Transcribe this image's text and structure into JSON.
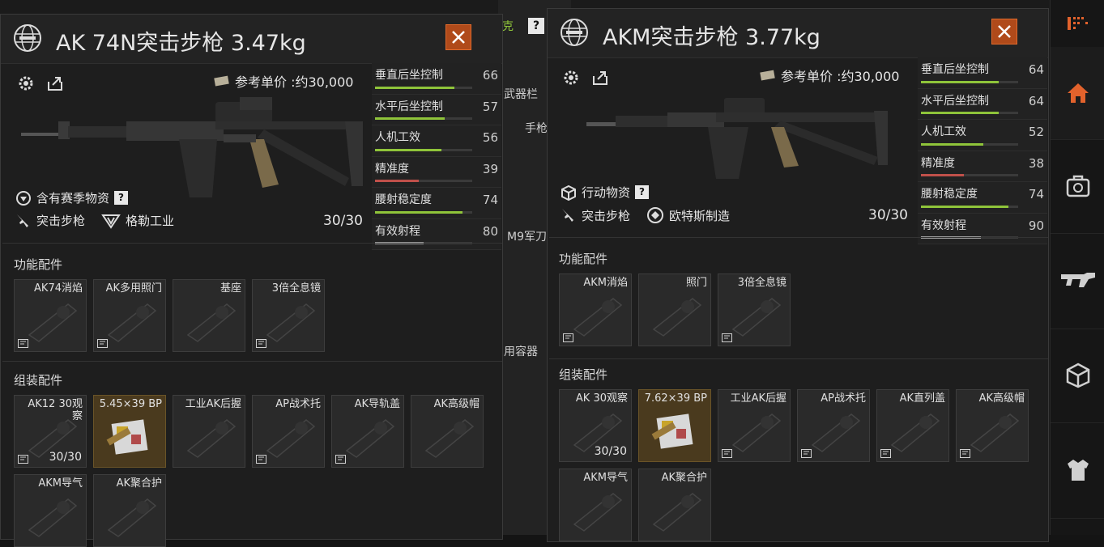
{
  "background": {
    "fragments": [
      "克",
      "武器栏",
      "手枪",
      "M9军刀",
      "用容器"
    ],
    "help_mark": "?"
  },
  "rail": {
    "items": [
      {
        "icon": "inventory-icon",
        "active": false
      },
      {
        "icon": "home-icon",
        "active": true
      },
      {
        "icon": "medkit-icon",
        "active": false
      },
      {
        "icon": "rifle-icon",
        "active": false
      },
      {
        "icon": "box-icon",
        "active": false
      },
      {
        "icon": "vest-icon",
        "active": false
      }
    ]
  },
  "panel_left": {
    "title": "AK 74N突击步枪 3.47kg",
    "price": "参考单价 :约30,000",
    "tag": "含有赛季物资",
    "help_mark": "?",
    "weapon_type": "突击步枪",
    "manufacturer": "格勒工业",
    "ammo": "30/30",
    "stats": [
      {
        "label": "垂直后坐控制",
        "value": "66",
        "fraction": 0.82,
        "color": "#8fc43a"
      },
      {
        "label": "水平后坐控制",
        "value": "57",
        "fraction": 0.72,
        "color": "#8fc43a"
      },
      {
        "label": "人机工效",
        "value": "56",
        "fraction": 0.68,
        "color": "#8fc43a"
      },
      {
        "label": "精准度",
        "value": "39",
        "fraction": 0.45,
        "color": "#c0504a"
      },
      {
        "label": "腰射稳定度",
        "value": "74",
        "fraction": 0.9,
        "color": "#8fc43a"
      },
      {
        "label": "有效射程",
        "value": "80",
        "fraction": 0.5,
        "color": "#9a9a9a"
      }
    ],
    "functional_title": "功能配件",
    "functional": [
      {
        "label": "AK74消焰",
        "gold": false,
        "count": "",
        "tag": true
      },
      {
        "label": "AK多用照门",
        "gold": false,
        "count": "",
        "tag": true
      },
      {
        "label": "基座",
        "gold": false,
        "count": "",
        "tag": false
      },
      {
        "label": "3倍全息镜",
        "gold": false,
        "count": "",
        "tag": true
      }
    ],
    "assembly_title": "组装配件",
    "assembly": [
      {
        "label": "AK12 30观察",
        "gold": false,
        "count": "30/30",
        "tag": true
      },
      {
        "label": "5.45×39 BP",
        "gold": true,
        "count": "",
        "tag": false
      },
      {
        "label": "工业AK后握",
        "gold": false,
        "count": "",
        "tag": false
      },
      {
        "label": "AP战术托",
        "gold": false,
        "count": "",
        "tag": true
      },
      {
        "label": "AK导轨盖",
        "gold": false,
        "count": "",
        "tag": true
      },
      {
        "label": "AK高级帽",
        "gold": false,
        "count": "",
        "tag": false
      },
      {
        "label": "AKM导气",
        "gold": false,
        "count": "",
        "tag": false
      },
      {
        "label": "AK聚合护",
        "gold": false,
        "count": "",
        "tag": false
      }
    ]
  },
  "panel_right": {
    "title": "AKM突击步枪 3.77kg",
    "price": "参考单价 :约30,000",
    "tag": "行动物资",
    "help_mark": "?",
    "weapon_type": "突击步枪",
    "manufacturer": "欧特斯制造",
    "ammo": "30/30",
    "stats": [
      {
        "label": "垂直后坐控制",
        "value": "64",
        "fraction": 0.8,
        "color": "#8fc43a"
      },
      {
        "label": "水平后坐控制",
        "value": "64",
        "fraction": 0.8,
        "color": "#8fc43a"
      },
      {
        "label": "人机工效",
        "value": "52",
        "fraction": 0.64,
        "color": "#8fc43a"
      },
      {
        "label": "精准度",
        "value": "38",
        "fraction": 0.44,
        "color": "#c0504a"
      },
      {
        "label": "腰射稳定度",
        "value": "74",
        "fraction": 0.9,
        "color": "#8fc43a"
      },
      {
        "label": "有效射程",
        "value": "90",
        "fraction": 0.62,
        "color": "#9a9a9a"
      }
    ],
    "functional_title": "功能配件",
    "functional": [
      {
        "label": "AKM消焰",
        "gold": false,
        "count": "",
        "tag": true
      },
      {
        "label": "照门",
        "gold": false,
        "count": "",
        "tag": false
      },
      {
        "label": "3倍全息镜",
        "gold": false,
        "count": "",
        "tag": true
      }
    ],
    "assembly_title": "组装配件",
    "assembly": [
      {
        "label": "AK 30观察",
        "gold": false,
        "count": "30/30",
        "tag": false
      },
      {
        "label": "7.62×39 BP",
        "gold": true,
        "count": "",
        "tag": false
      },
      {
        "label": "工业AK后握",
        "gold": false,
        "count": "",
        "tag": true
      },
      {
        "label": "AP战术托",
        "gold": false,
        "count": "",
        "tag": true
      },
      {
        "label": "AK直列盖",
        "gold": false,
        "count": "",
        "tag": true
      },
      {
        "label": "AK高级帽",
        "gold": false,
        "count": "",
        "tag": true
      },
      {
        "label": "AKM导气",
        "gold": false,
        "count": "",
        "tag": false
      },
      {
        "label": "AK聚合护",
        "gold": false,
        "count": "",
        "tag": false
      }
    ]
  }
}
